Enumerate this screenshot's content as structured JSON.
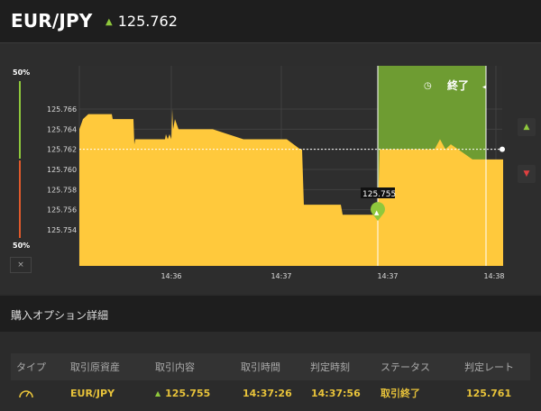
{
  "header": {
    "pair": "EUR/JPY",
    "rate": "125.762",
    "rate_direction_icon": "up-arrow-icon"
  },
  "gauge": {
    "top_label": "50%",
    "bottom_label": "50%",
    "close_label": "×"
  },
  "controls": {
    "up_icon": "up-arrow-icon",
    "down_icon": "down-arrow-icon"
  },
  "chart": {
    "expiry_label": "終了",
    "expiry_icon": "clock-icon",
    "entry_label": "125.755",
    "colors": {
      "area": "#ffc93c",
      "expiry_zone": "#6e9c32",
      "line": "#ffffff"
    }
  },
  "chart_data": {
    "type": "area",
    "y_ticks": [
      "125.766",
      "125.764",
      "125.762",
      "125.760",
      "125.758",
      "125.756",
      "125.754"
    ],
    "x_ticks": [
      "14:36",
      "14:37",
      "14:37",
      "14:38"
    ],
    "ylim": [
      125.752,
      125.768
    ],
    "current_line": 125.762,
    "series": [
      {
        "values": [
          [
            0,
            125.764
          ],
          [
            4,
            125.765
          ],
          [
            10,
            125.7655
          ],
          [
            18,
            125.7655
          ],
          [
            36,
            125.7655
          ],
          [
            37,
            125.765
          ],
          [
            60,
            125.765
          ],
          [
            61,
            125.7625
          ],
          [
            62,
            125.763
          ],
          [
            95,
            125.763
          ],
          [
            96,
            125.7635
          ],
          [
            98,
            125.763
          ],
          [
            100,
            125.7635
          ],
          [
            102,
            125.763
          ],
          [
            103,
            125.766
          ],
          [
            104,
            125.764
          ],
          [
            106,
            125.765
          ],
          [
            110,
            125.764
          ],
          [
            118,
            125.764
          ],
          [
            148,
            125.764
          ],
          [
            182,
            125.763
          ],
          [
            230,
            125.763
          ],
          [
            245,
            125.762
          ],
          [
            247,
            125.762
          ],
          [
            249,
            125.7565
          ],
          [
            290,
            125.7565
          ],
          [
            292,
            125.7555
          ],
          [
            330,
            125.7555
          ],
          [
            331,
            125.7555
          ],
          [
            333,
            125.762
          ],
          [
            337,
            125.762
          ],
          [
            345,
            125.762
          ],
          [
            394,
            125.762
          ],
          [
            400,
            125.763
          ],
          [
            406,
            125.762
          ],
          [
            412,
            125.7625
          ],
          [
            420,
            125.762
          ],
          [
            436,
            125.761
          ],
          [
            470,
            125.761
          ]
        ]
      }
    ]
  },
  "details": {
    "title": "購入オプション詳細",
    "columns": [
      "タイプ",
      "取引原資産",
      "取引内容",
      "取引時間",
      "判定時刻",
      "ステータス",
      "判定レート"
    ],
    "row": {
      "type_icon": "gauge-icon",
      "asset": "EUR/JPY",
      "trade": "125.755",
      "trade_time": "14:37:26",
      "judge_time": "14:37:56",
      "status": "取引終了",
      "rate": "125.761"
    }
  }
}
